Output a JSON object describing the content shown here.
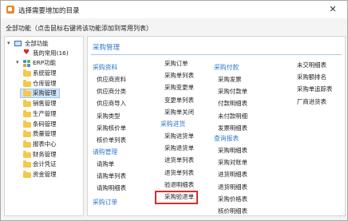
{
  "window": {
    "title": "选择需要增加的目录",
    "close_glyph": "✕"
  },
  "hint": "全部功能（点击鼠标右键将该功能添加到常用列表）",
  "tree": {
    "root_label": "全部功能",
    "favorites_label": "我的常用(16)",
    "erp_label": "ERP功能",
    "modules": [
      "系统管理",
      "仓库管理",
      "采购管理",
      "销售管理",
      "生产管理",
      "条码管理",
      "质量管理",
      "报表中心",
      "财务管理",
      "会计凭证",
      "资金管理"
    ],
    "selected_index": 2
  },
  "panel": {
    "title": "采购管理",
    "columns": [
      {
        "sections": [
          {
            "heading": "采购资料",
            "items": [
              "供应商资料",
              "供应商分类",
              "供应商导入",
              "采购类型",
              "采购核价单",
              "核价单列表"
            ]
          },
          {
            "heading": "请购管理",
            "items": [
              "请购单",
              "请购单列表",
              "请购明细表"
            ]
          },
          {
            "heading": "采购订单",
            "items": []
          }
        ]
      },
      {
        "sections": [
          {
            "heading": "",
            "items": [
              "采购订单",
              "采购单列表",
              "采购变更单",
              "变更单列表",
              "采购单关闭"
            ]
          },
          {
            "heading": "采购进货",
            "items": [
              "采购进货单",
              "采购退货单",
              "进货单列表",
              "退货单列表",
              "验退明细表",
              "采购验退单"
            ]
          }
        ]
      },
      {
        "sections": [
          {
            "heading": "采购付款",
            "items": [
              "采购发票",
              "采购付款单",
              "付款明细表",
              "未付款明细",
              "发票明细表"
            ]
          },
          {
            "heading": "查询报表",
            "items": [
              "采购明细表",
              "采购对账单",
              "进货明细表",
              "退货明细表",
              "采购价格表",
              "核价明细表"
            ]
          }
        ]
      },
      {
        "sections": [
          {
            "heading": "",
            "items": [
              "未交明细表",
              "采购额排名",
              "采购单追踪表",
              "厂商进货表"
            ]
          }
        ]
      }
    ],
    "highlighted_item": "采购验退单",
    "highlight_color": "#e02a2a",
    "accent_color": "#2e78c9"
  }
}
